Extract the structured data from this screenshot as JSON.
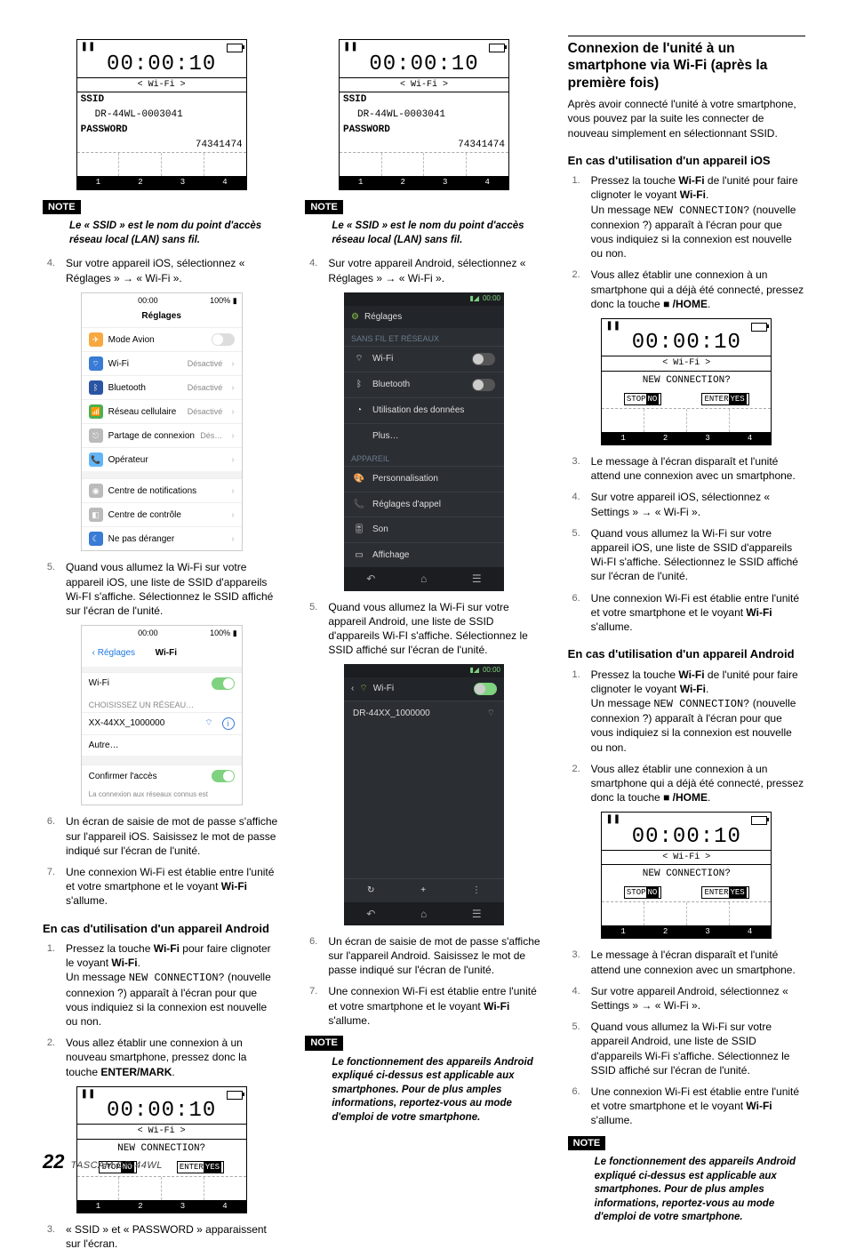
{
  "footer": {
    "page": "22",
    "model": "TASCAM  DR-44WL"
  },
  "lcd": {
    "time": "00:00:10",
    "wifi_bar": "<  Wi-Fi  >",
    "ssid_label": "SSID",
    "ssid_value": "DR-44WL-0003041",
    "pass_label": "PASSWORD",
    "pass_value": "74341474",
    "new_conn": "NEW CONNECTION?",
    "btn_stop": "STOP",
    "btn_no": "NO",
    "btn_enter": "ENTER",
    "btn_yes": "YES",
    "t1": "1",
    "t2": "2",
    "t3": "3",
    "t4": "4",
    "pause": "❚❚"
  },
  "ios_settings": {
    "time": "00:00",
    "batt": "100%",
    "title": "Réglages",
    "airplane": "Mode Avion",
    "wifi": "Wi-Fi",
    "wifi_state": "Désactivé",
    "bt": "Bluetooth",
    "bt_state": "Désactivé",
    "cell": "Réseau cellulaire",
    "cell_state": "Désactivé",
    "hotspot": "Partage de connexion",
    "hotspot_state": "Dés…",
    "carrier": "Opérateur",
    "notif": "Centre de notifications",
    "control": "Centre de contrôle",
    "dnd": "Ne pas déranger"
  },
  "ios_wifi": {
    "time": "00:00",
    "batt": "100%",
    "back": "Réglages",
    "title": "Wi-Fi",
    "row_wifi": "Wi-Fi",
    "section": "CHOISISSEZ UN RÉSEAU…",
    "ssid": "XX-44XX_1000000",
    "other": "Autre…",
    "ask": "Confirmer l'accès",
    "fine": "La connexion aux réseaux connus est"
  },
  "android_settings": {
    "clock": "00:00",
    "title": "Réglages",
    "sect1": "SANS FIL ET RÉSEAUX",
    "wifi": "Wi-Fi",
    "bt": "Bluetooth",
    "data": "Utilisation des données",
    "more": "Plus…",
    "sect2": "APPAREIL",
    "perso": "Personnalisation",
    "call": "Réglages d'appel",
    "sound": "Son",
    "display": "Affichage"
  },
  "android_wifi": {
    "clock": "00:00",
    "title": "Wi-Fi",
    "ssid": "DR-44XX_1000000",
    "plus": "+"
  },
  "col1": {
    "note": "NOTE",
    "note1": "Le « SSID » est le nom du point d'accès réseau local (LAN) sans fil.",
    "s4": "Sur votre appareil iOS, sélectionnez « Réglages »  →  « Wi-Fi ».",
    "s5": "Quand vous allumez la Wi-Fi sur votre appareil iOS, une liste de SSID d'appareils Wi-FI s'affiche. Sélectionnez le SSID affiché sur l'écran de l'unité.",
    "s6": "Un écran de saisie de mot de passe s'affiche sur l'appareil iOS. Saisissez le mot de passe indiqué sur l'écran de l'unité.",
    "s7_a": "Une connexion Wi-Fi est établie entre l'unité et votre smartphone et le voyant ",
    "s7_b": " s'allume.",
    "h_android": "En cas d'utilisation d'un appareil Android",
    "a1_a": "Pressez la touche ",
    "a1_b": " pour faire clignoter le voyant ",
    "a1_c": ".",
    "a1_msg_a": "Un message ",
    "a1_msg_mono": "NEW CONNECTION?",
    "a1_msg_b": " (nouvelle connexion ?) apparaît à l'écran pour que vous indiquiez si la connexion est nouvelle ou non.",
    "a2_a": "Vous allez établir une connexion à un nouveau smartphone, pressez donc la touche ",
    "a2_b": ".",
    "a3": "« SSID » et « PASSWORD » apparaissent sur l'écran.",
    "wifi_bold": "Wi-Fi",
    "enter_mark": "ENTER/MARK"
  },
  "col2": {
    "note": "NOTE",
    "note1": "Le « SSID » est le nom du point d'accès réseau local (LAN) sans fil.",
    "s4": "Sur votre appareil Android, sélectionnez « Réglages »  →  « Wi-Fi ».",
    "s5": "Quand vous allumez la Wi-Fi sur votre appareil Android, une liste de SSID d'appareils Wi-FI s'affiche. Sélectionnez le SSID affiché sur l'écran de l'unité.",
    "s6": "Un écran de saisie de mot de passe s'affiche sur l'appareil Android. Saisissez le mot de passe indiqué sur l'écran de l'unité.",
    "s7_a": "Une connexion Wi-Fi est établie entre l'unité et votre smartphone et le voyant ",
    "s7_b": " s'allume.",
    "note2": "Le fonctionnement des appareils Android expliqué ci-dessus est applicable aux smartphones. Pour de plus amples informations, reportez-vous au mode d'emploi de votre smartphone.",
    "wifi_bold": "Wi-Fi"
  },
  "col3": {
    "h2": "Connexion de l'unité à un smartphone via Wi-Fi (après la première fois)",
    "intro": "Après avoir connecté l'unité à votre smartphone, vous pouvez par la suite les connecter de nouveau simplement en sélectionnant SSID.",
    "h_ios": "En cas d'utilisation d'un appareil iOS",
    "i1_a": "Pressez la touche ",
    "i1_b": " de l'unité pour faire clignoter le voyant ",
    "i1_c": ".",
    "i1_msg_a": "Un message ",
    "i1_msg_mono": "NEW CONNECTION?",
    "i1_msg_b": " (nouvelle connexion ?) apparaît à l'écran pour que vous indiquiez si la connexion est nouvelle ou non.",
    "i2_a": "Vous allez établir une connexion à un smartphone qui a déjà été connecté, pressez donc la touche ",
    "i2_home": "/HOME",
    "i2_b": ".",
    "i3": "Le message à l'écran disparaît et l'unité attend une connexion avec un smartphone.",
    "i4": "Sur votre appareil iOS, sélectionnez « Settings »  →  « Wi-Fi ».",
    "i5": "Quand vous allumez la Wi-Fi sur votre appareil iOS, une liste de SSID d'appareils Wi-FI s'affiche. Sélectionnez le SSID affiché sur l'écran de l'unité.",
    "i6_a": "Une connexion Wi-Fi est établie entre l'unité et votre smartphone et le voyant ",
    "i6_b": " s'allume.",
    "h_android": "En cas d'utilisation d'un appareil Android",
    "a1_a": "Pressez la touche ",
    "a1_b": " de l'unité pour faire clignoter le voyant ",
    "a1_c": ".",
    "a2_a": "Vous allez établir une connexion à un smartphone qui a déjà été connecté, pressez donc la touche ",
    "a3": "Le message à l'écran disparaît et l'unité attend une connexion avec un smartphone.",
    "a4": "Sur votre appareil Android, sélectionnez « Settings »  →  « Wi-Fi ».",
    "a5": "Quand vous allumez la Wi-Fi sur votre appareil Android, une liste de SSID d'appareils Wi-Fi s'affiche. Sélectionnez le SSID affiché sur l'écran de l'unité.",
    "a6_a": "Une connexion Wi-Fi est établie entre l'unité et votre smartphone et le voyant ",
    "a6_b": " s'allume.",
    "note": "NOTE",
    "note_text": "Le fonctionnement des appareils Android expliqué ci-dessus est applicable aux smartphones. Pour de plus amples informations, reportez-vous au mode d'emploi de votre smartphone.",
    "wifi_bold": "Wi-Fi"
  }
}
